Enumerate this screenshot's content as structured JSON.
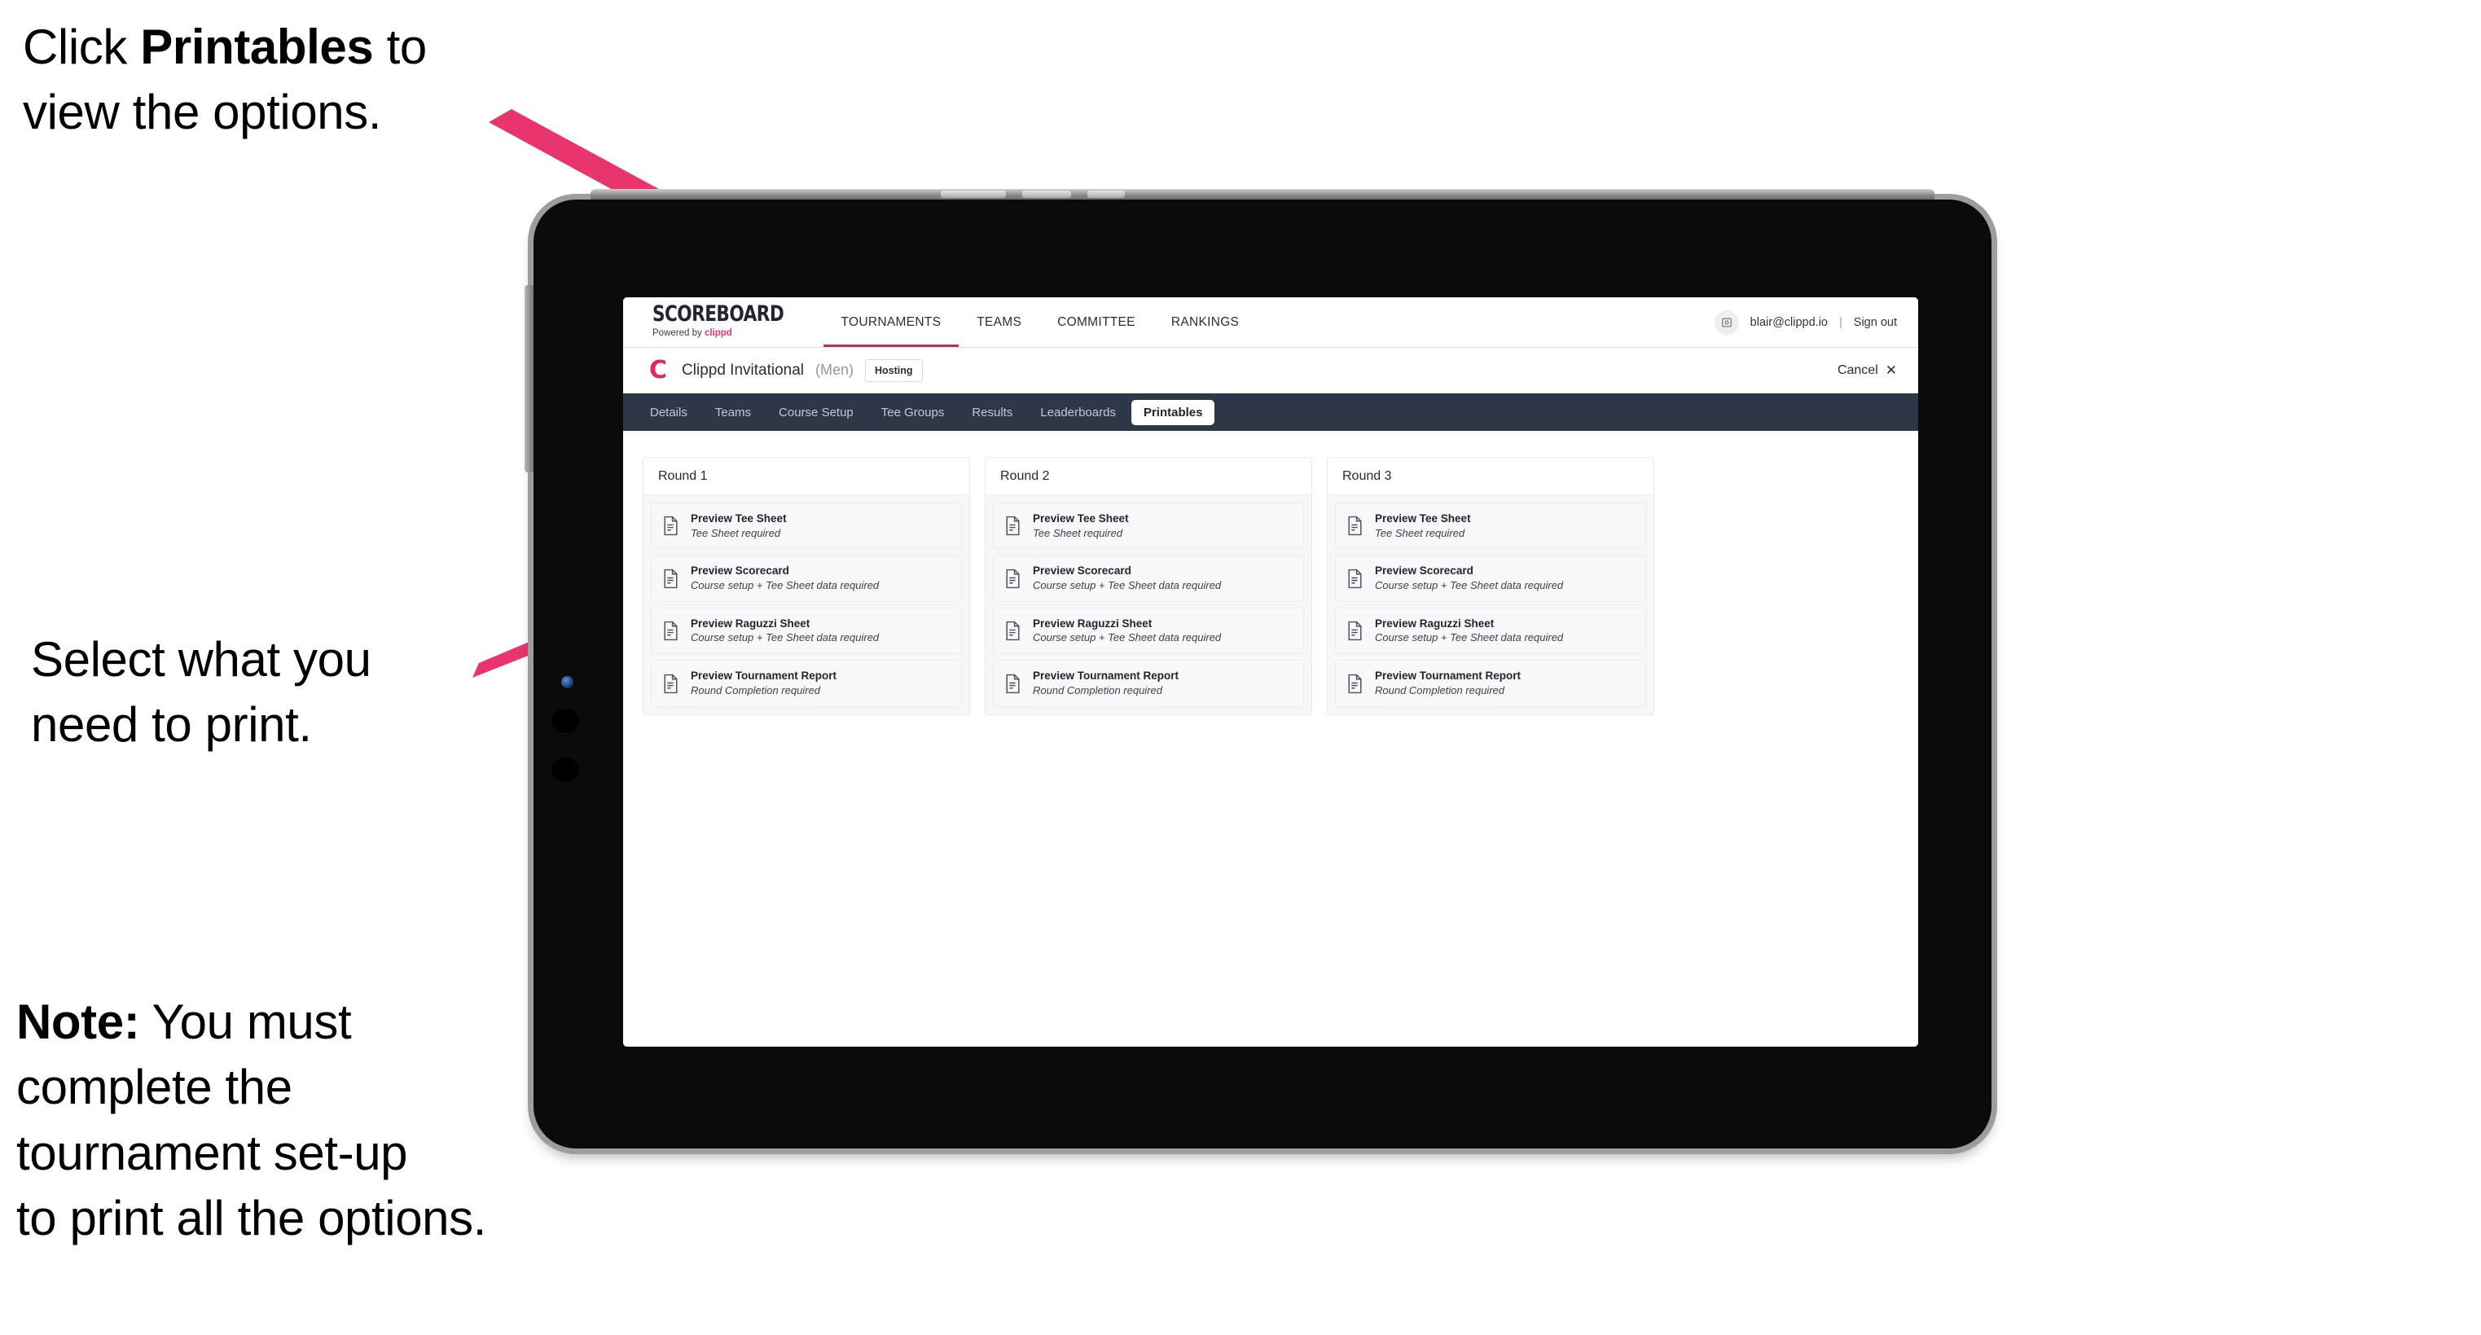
{
  "annotations": {
    "click_printables": {
      "line1_pre": "Click ",
      "line1_bold": "Printables",
      "line1_post": " to",
      "line2": "view the options."
    },
    "select_print": {
      "line1": "Select what you",
      "line2": " need to print."
    },
    "note": {
      "label": "Note:",
      "line1_rest": " You must",
      "line2": "complete the",
      "line3": "tournament set-up",
      "line4": "to print all the options."
    },
    "arrow_color": "#e8356d"
  },
  "app": {
    "brand": {
      "name": "SCOREBOARD",
      "sub_prefix": "Powered by ",
      "sub_mark": "clippd"
    },
    "main_nav": [
      {
        "label": "TOURNAMENTS",
        "active": true
      },
      {
        "label": "TEAMS",
        "active": false
      },
      {
        "label": "COMMITTEE",
        "active": false
      },
      {
        "label": "RANKINGS",
        "active": false
      }
    ],
    "header_right": {
      "avatar_icon": "user-avatar-icon",
      "email": "blair@clippd.io",
      "separator": "|",
      "sign_out": "Sign out"
    },
    "tournament_bar": {
      "logo_letter": "C",
      "name": "Clippd Invitational",
      "gender": "(Men)",
      "badge": "Hosting",
      "cancel_label": "Cancel",
      "cancel_icon": "close-icon"
    },
    "tabs": [
      {
        "label": "Details",
        "active": false
      },
      {
        "label": "Teams",
        "active": false
      },
      {
        "label": "Course Setup",
        "active": false
      },
      {
        "label": "Tee Groups",
        "active": false
      },
      {
        "label": "Results",
        "active": false
      },
      {
        "label": "Leaderboards",
        "active": false
      },
      {
        "label": "Printables",
        "active": true
      }
    ],
    "rounds": [
      {
        "title": "Round 1",
        "items": [
          {
            "title": "Preview Tee Sheet",
            "sub": "Tee Sheet required"
          },
          {
            "title": "Preview Scorecard",
            "sub": "Course setup + Tee Sheet data required"
          },
          {
            "title": "Preview Raguzzi Sheet",
            "sub": "Course setup + Tee Sheet data required"
          },
          {
            "title": "Preview Tournament Report",
            "sub": "Round Completion required"
          }
        ]
      },
      {
        "title": "Round 2",
        "items": [
          {
            "title": "Preview Tee Sheet",
            "sub": "Tee Sheet required"
          },
          {
            "title": "Preview Scorecard",
            "sub": "Course setup + Tee Sheet data required"
          },
          {
            "title": "Preview Raguzzi Sheet",
            "sub": "Course setup + Tee Sheet data required"
          },
          {
            "title": "Preview Tournament Report",
            "sub": "Round Completion required"
          }
        ]
      },
      {
        "title": "Round 3",
        "items": [
          {
            "title": "Preview Tee Sheet",
            "sub": "Tee Sheet required"
          },
          {
            "title": "Preview Scorecard",
            "sub": "Course setup + Tee Sheet data required"
          },
          {
            "title": "Preview Raguzzi Sheet",
            "sub": "Course setup + Tee Sheet data required"
          },
          {
            "title": "Preview Tournament Report",
            "sub": "Round Completion required"
          }
        ]
      }
    ]
  },
  "colors": {
    "accent_pink": "#e8356d",
    "nav_dark": "#2d3748",
    "brand_red": "#e2275c",
    "active_underline": "#b5364f"
  }
}
